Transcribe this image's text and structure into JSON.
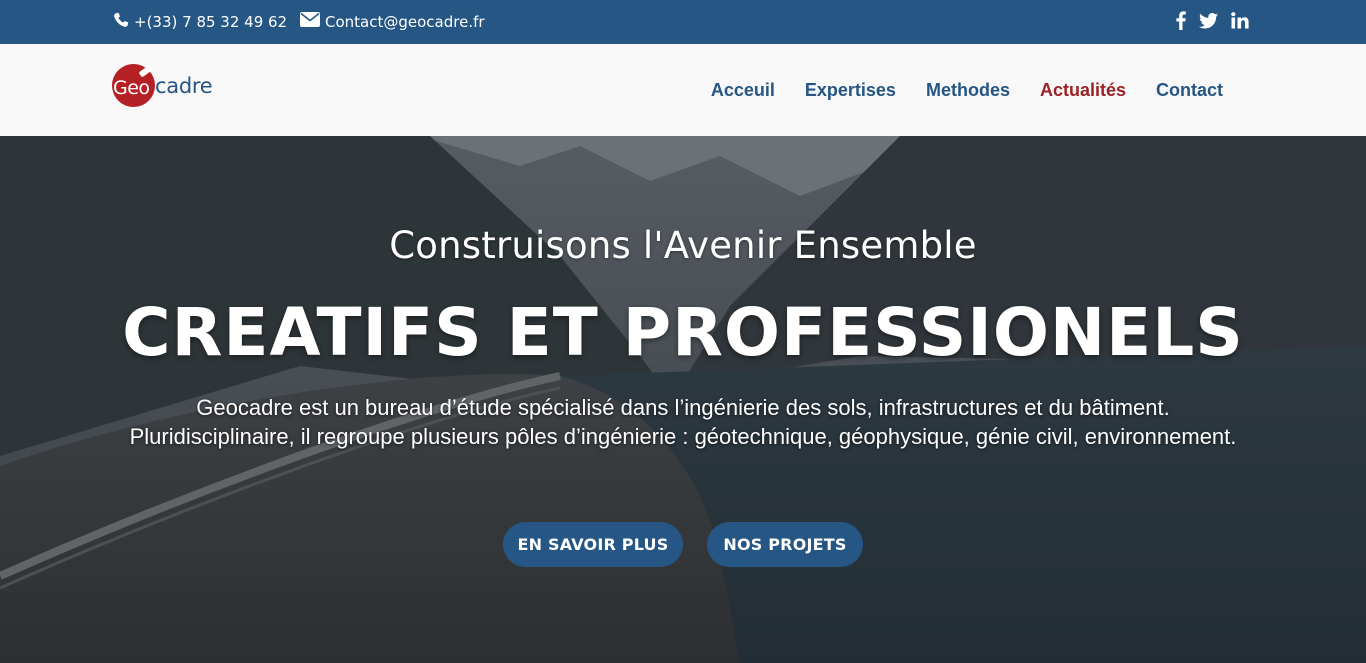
{
  "topbar": {
    "phone": "+(33) 7 85 32 49 62",
    "email": "Contact@geocadre.fr",
    "social": [
      "facebook-icon",
      "twitter-icon",
      "linkedin-icon"
    ],
    "background": "#255684"
  },
  "logo": {
    "geo": "Geo",
    "cadre": "cadre",
    "colors": {
      "circle": "#b52025",
      "text": "#255684"
    }
  },
  "nav": {
    "items": [
      {
        "label": "Acceuil"
      },
      {
        "label": "Expertises"
      },
      {
        "label": "Methodes"
      },
      {
        "label": "Actualités",
        "active": true
      },
      {
        "label": "Contact"
      }
    ],
    "colors": {
      "default": "#255684",
      "active": "#9b2226"
    }
  },
  "hero": {
    "subtitle": "Construisons l'Avenir Ensemble",
    "headline": "CREATIFS ET PROFESSIONELS",
    "description_line1": "Geocadre est un bureau d’étude spécialisé dans l’ingénierie des sols, infrastructures et du bâtiment.",
    "description_line2": "Pluridisciplinaire, il regroupe plusieurs pôles d’ingénierie : géotechnique, géophysique, génie civil, environnement.",
    "buttons": [
      {
        "label": "EN SAVOIR PLUS"
      },
      {
        "label": "NOS PROJETS"
      }
    ]
  }
}
